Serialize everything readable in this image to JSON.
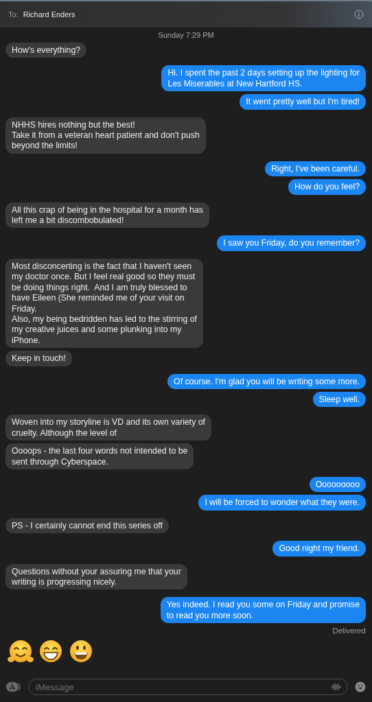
{
  "header": {
    "to_label": "To:",
    "recipient": "Richard Enders"
  },
  "timestamp": "Sunday 7:29 PM",
  "messages": [
    {
      "kind": "received",
      "text": "How's everything?"
    },
    {
      "kind": "sent",
      "text": "Hi. I spent the past 2 days setting up the lighting for\nLes Miserables at New Hartford HS."
    },
    {
      "kind": "sent",
      "text": "It went pretty well but I'm tired!"
    },
    {
      "kind": "received",
      "text": "NHHS hires nothing but the best!\nTake it from a veteran heart patient and don't push\nbeyond the limits!"
    },
    {
      "kind": "sent",
      "text": "Right, I've been careful."
    },
    {
      "kind": "sent",
      "text": "How do you feel?"
    },
    {
      "kind": "received",
      "text": "All this crap of being in the hospital for a month has\nleft me a bit discombobulated!"
    },
    {
      "kind": "sent",
      "text": "I saw you Friday, do you remember?"
    },
    {
      "kind": "received",
      "text": "Most disconcerting is the fact that I haven't seen\nmy doctor once. But I feel real good so they must\nbe doing things right.  And I am truly blessed to\nhave Eileen (She reminded me of your visit on\nFriday.\nAlso, my being bedridden has led to the stirring of\nmy creative juices and some plunking into my\niPhone."
    },
    {
      "kind": "received",
      "text": "Keep in touch!"
    },
    {
      "kind": "sent",
      "text": "Of course. I'm glad you will be writing some more."
    },
    {
      "kind": "sent",
      "text": "Sleep well."
    },
    {
      "kind": "received",
      "text": "Woven into my storyline is VD and its own variety of\ncruelty. Although the level of"
    },
    {
      "kind": "received",
      "text": "Oooops - the last four words not intended to be\nsent through Cyberspace."
    },
    {
      "kind": "sent",
      "text": "Ooooooooo"
    },
    {
      "kind": "sent",
      "text": "I will be forced to wonder what they were."
    },
    {
      "kind": "received",
      "text": "PS - I certainly cannot end this series off"
    },
    {
      "kind": "sent",
      "text": "Good night my friend."
    },
    {
      "kind": "received",
      "text": "Questions without your assuring me that your\nwriting is progressing nicely."
    },
    {
      "kind": "sent",
      "text": "Yes indeed. I read you some on Friday and promise\nto read you more soon."
    }
  ],
  "status": "Delivered",
  "emoji_row": [
    {
      "kind": "hug"
    },
    {
      "kind": "beaming"
    },
    {
      "kind": "grin"
    }
  ],
  "composer": {
    "placeholder": "iMessage"
  }
}
